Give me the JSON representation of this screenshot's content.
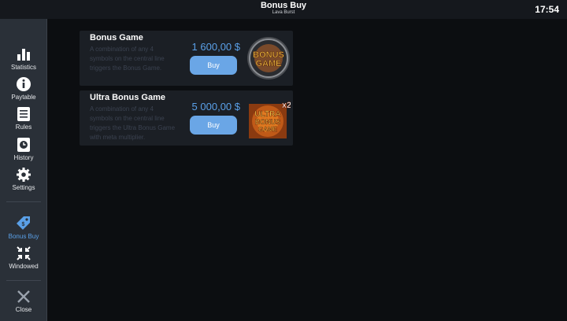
{
  "header": {
    "title": "Bonus Buy",
    "subtitle": "Lava Burst",
    "clock": "17:54"
  },
  "sidebar": {
    "items": [
      {
        "label": "Statistics",
        "icon": "bar-chart-icon"
      },
      {
        "label": "Paytable",
        "icon": "info-icon"
      },
      {
        "label": "Rules",
        "icon": "list-icon"
      },
      {
        "label": "History",
        "icon": "clock-icon"
      },
      {
        "label": "Settings",
        "icon": "gear-icon"
      },
      {
        "label": "Bonus Buy",
        "icon": "tag-icon",
        "active": true
      },
      {
        "label": "Windowed",
        "icon": "shrink-icon"
      },
      {
        "label": "Close",
        "icon": "close-icon"
      }
    ]
  },
  "bonuses": [
    {
      "name": "Bonus Game",
      "description": "A combination of any 4 symbols on the central line triggers the Bonus Game.",
      "price": "1 600,00 $",
      "buy_label": "Buy",
      "badge_text": [
        "BONUS",
        "GAME"
      ]
    },
    {
      "name": "Ultra Bonus Game",
      "description": "A combination of any 4 symbols on the central line triggers the Ultra Bonus Game with meta multiplier.",
      "price": "5 000,00 $",
      "buy_label": "Buy",
      "badge_text": [
        "ULTRA",
        "BONUS",
        "GAME"
      ],
      "badge_multiplier": "x2"
    }
  ],
  "colors": {
    "accent": "#5aa0e8",
    "button": "#6aa6e6",
    "sidebar": "#2a3038",
    "card": "#1b1f25",
    "background": "#0c0e11"
  }
}
